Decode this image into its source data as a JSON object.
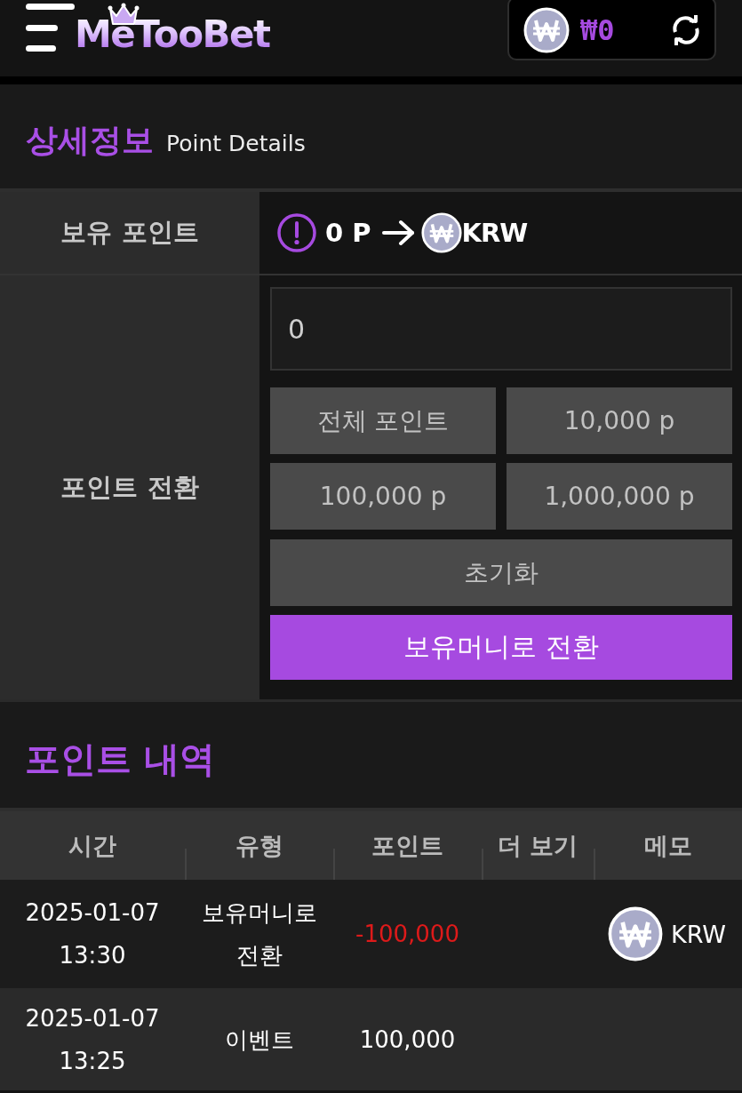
{
  "header": {
    "logo": "MeTooBet",
    "balance": "₩0"
  },
  "point_details": {
    "title": "상세정보",
    "subtitle": "Point Details",
    "held_points": {
      "label": "보유 포인트",
      "points": "0 P",
      "currency": "KRW"
    },
    "conversion": {
      "label": "포인트 전환",
      "amount_value": "0",
      "quick_buttons": [
        "전체 포인트",
        "10,000 p",
        "100,000 p",
        "1,000,000 p"
      ],
      "reset_button": "초기화",
      "convert_button": "보유머니로 전환"
    }
  },
  "history": {
    "title": "포인트 내역",
    "columns": [
      "시간",
      "유형",
      "포인트",
      "더 보기",
      "메모"
    ],
    "rows": [
      {
        "time": "2025-01-07 13:30",
        "type": "보유머니로 전환",
        "points": "-100,000",
        "color": "#dd1a1a",
        "memo": "KRW"
      },
      {
        "time": "2025-01-07 13:25",
        "type": "이벤트",
        "points": "100,000",
        "color": "#ffffff"
      }
    ]
  }
}
